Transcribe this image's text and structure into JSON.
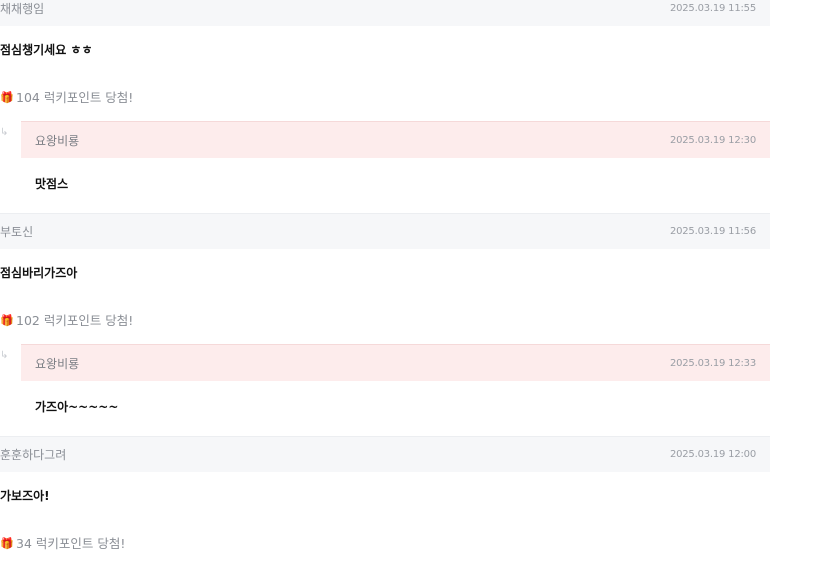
{
  "comments": [
    {
      "author": "채채행임",
      "date": "2025.03.19 11:55",
      "text": "점심챙기세요 ㅎㅎ",
      "lucky": "104 럭키포인트 당첨!",
      "reply": {
        "author": "요왕비룡",
        "date": "2025.03.19 12:30",
        "text": "맛점스"
      }
    },
    {
      "author": "부토신",
      "date": "2025.03.19 11:56",
      "text": "점심바리가즈아",
      "lucky": "102 럭키포인트 당첨!",
      "reply": {
        "author": "요왕비룡",
        "date": "2025.03.19 12:33",
        "text": "가즈아~~~~~"
      }
    },
    {
      "author": "훈훈하다그려",
      "date": "2025.03.19 12:00",
      "text": "가보즈아!",
      "lucky": "34 럭키포인트 당첨!"
    }
  ],
  "icons": {
    "gift": "gift-icon",
    "reply": "reply-arrow-icon"
  }
}
